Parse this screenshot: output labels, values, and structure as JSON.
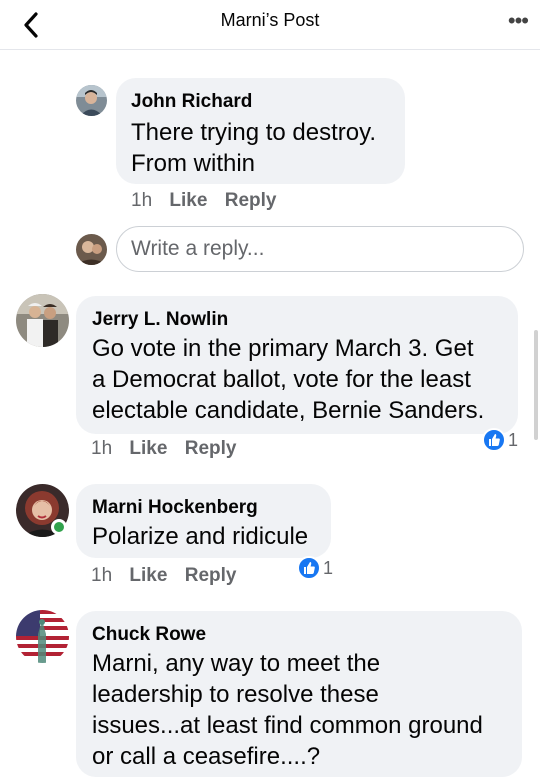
{
  "header": {
    "title": "Marni’s Post"
  },
  "reply_box": {
    "placeholder": "Write a reply..."
  },
  "comments": [
    {
      "author": "John Richard",
      "lines": [
        "There trying to destroy.",
        "From within"
      ],
      "time": "1h",
      "like": "Like",
      "reply": "Reply"
    },
    {
      "author": "Jerry L. Nowlin",
      "lines": [
        "Go vote in the primary March 3.  Get",
        "a Democrat ballot, vote for the least",
        "electable candidate, Bernie Sanders."
      ],
      "time": "1h",
      "like": "Like",
      "reply": "Reply",
      "reactions": "1"
    },
    {
      "author": "Marni Hockenberg",
      "lines": [
        "Polarize and ridicule"
      ],
      "time": "1h",
      "like": "Like",
      "reply": "Reply",
      "reactions": "1"
    },
    {
      "author": "Chuck Rowe",
      "lines": [
        "Marni, any way to meet the",
        "leadership to resolve these",
        "issues...at least find common ground",
        "or call a ceasefire....?"
      ]
    }
  ],
  "colors": {
    "bubble": "#f0f2f5",
    "meta": "#65676b",
    "like_blue": "#1877f2",
    "online": "#31a24c"
  },
  "icons": {
    "back": "chevron-left-icon",
    "more": "more-dots-icon",
    "like": "thumbs-up-icon"
  }
}
